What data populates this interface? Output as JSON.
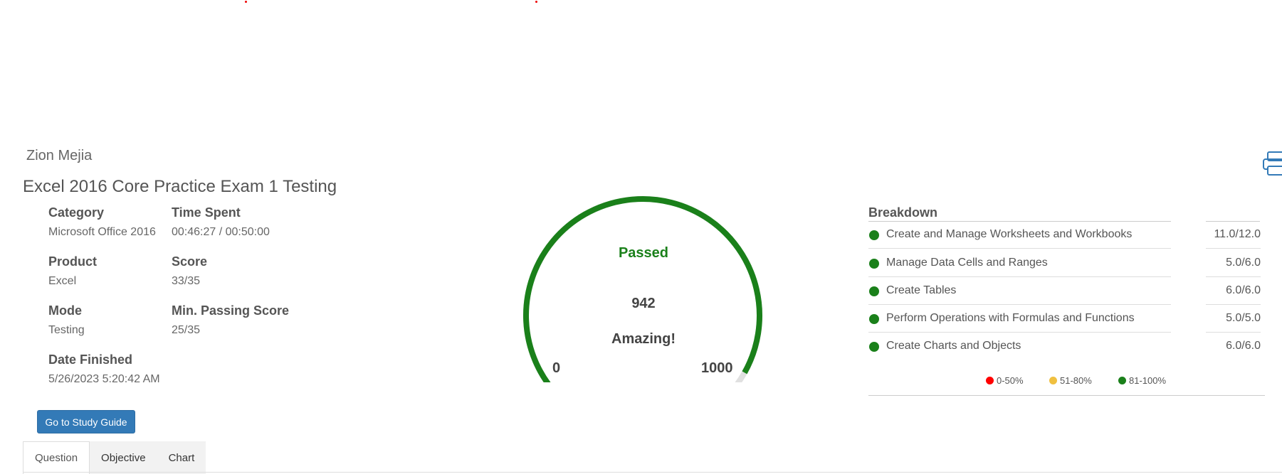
{
  "user": {
    "name": "Zion Mejia"
  },
  "exam": {
    "title": "Excel 2016 Core Practice Exam 1 Testing",
    "details": [
      {
        "label": "Category",
        "value": "Microsoft Office 2016"
      },
      {
        "label": "Time Spent",
        "value": "00:46:27 / 00:50:00"
      },
      {
        "label": "Product",
        "value": "Excel"
      },
      {
        "label": "Score",
        "value": "33/35"
      },
      {
        "label": "Mode",
        "value": "Testing"
      },
      {
        "label": "Min. Passing Score",
        "value": "25/35"
      },
      {
        "label": "Date Finished",
        "value": "5/26/2023 5:20:42 AM"
      }
    ],
    "study_button": "Go to Study Guide"
  },
  "gauge": {
    "status": "Passed",
    "score": "942",
    "message": "Amazing!",
    "min": "0",
    "max": "1000",
    "fraction": 0.942,
    "pass_color": "#1a801a",
    "track_color": "#e0e0e0"
  },
  "breakdown": {
    "title": "Breakdown",
    "rows": [
      {
        "label": "Create and Manage Worksheets and Workbooks",
        "value": "11.0/12.0",
        "color": "#1a801a"
      },
      {
        "label": "Manage Data Cells and Ranges",
        "value": "5.0/6.0",
        "color": "#1a801a"
      },
      {
        "label": "Create Tables",
        "value": "6.0/6.0",
        "color": "#1a801a"
      },
      {
        "label": "Perform Operations with Formulas and Functions",
        "value": "5.0/5.0",
        "color": "#1a801a"
      },
      {
        "label": "Create Charts and Objects",
        "value": "6.0/6.0",
        "color": "#1a801a"
      }
    ],
    "legend": [
      {
        "label": "0-50%",
        "color": "#ff0000"
      },
      {
        "label": "51-80%",
        "color": "#f0c040"
      },
      {
        "label": "81-100%",
        "color": "#1a801a"
      }
    ]
  },
  "tabs": [
    {
      "label": "Question",
      "active": true
    },
    {
      "label": "Objective",
      "active": false
    },
    {
      "label": "Chart",
      "active": false
    }
  ],
  "icons": {
    "print": "print-icon"
  }
}
